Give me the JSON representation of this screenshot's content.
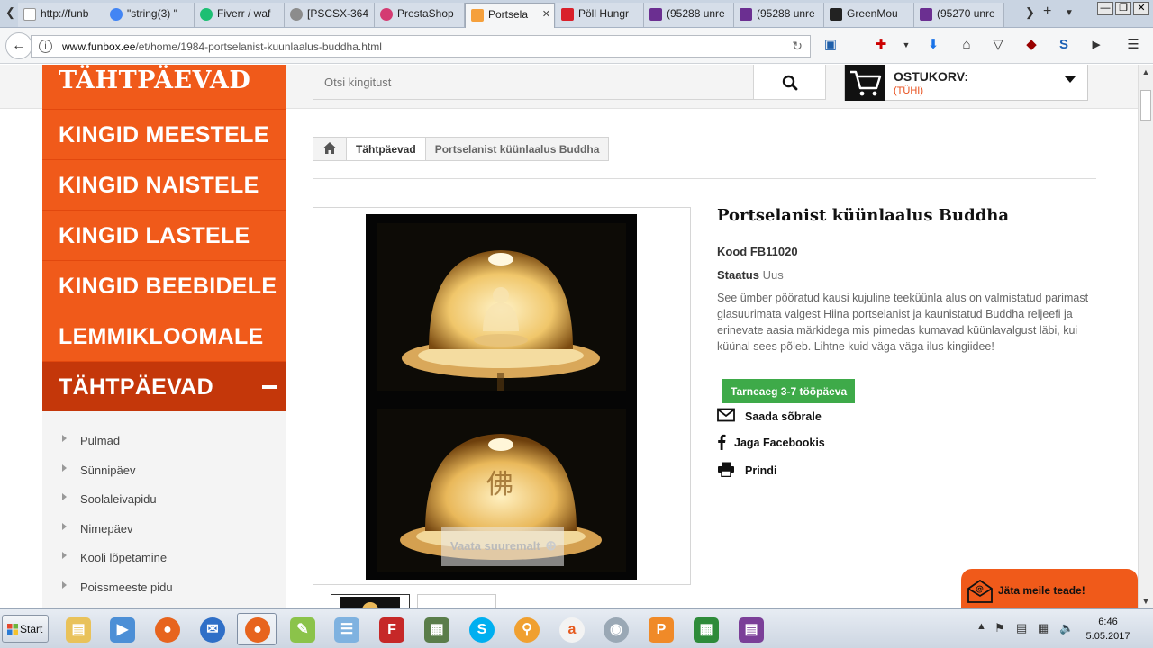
{
  "browser": {
    "tabs": [
      {
        "title": "http://funb",
        "color": "#b9c3cf"
      },
      {
        "title": "\"string(3) \"",
        "color": "#4285f4"
      },
      {
        "title": "Fiverr / waf",
        "color": "#1dbf73"
      },
      {
        "title": "[PSCSX-364",
        "color": "#8c8c8c"
      },
      {
        "title": "PrestaShop",
        "color": "#d43b72"
      },
      {
        "title": "Portsela",
        "color": "#f5a03c"
      },
      {
        "title": "Pöll Hungr",
        "color": "#d9202a"
      },
      {
        "title": "(95288 unre",
        "color": "#6b2f91"
      },
      {
        "title": "(95288 unre",
        "color": "#6b2f91"
      },
      {
        "title": "GreenMou",
        "color": "#222222"
      },
      {
        "title": "(95270 unre",
        "color": "#6b2f91"
      }
    ],
    "active_tab_index": 5,
    "url_host": "www.funbox.ee",
    "url_path": "/et/home/1984-portselanist-kuunlaalus-buddha.html"
  },
  "header": {
    "logo_text": "TÄHTPÄEVAD",
    "search_placeholder": "Otsi kingitust",
    "cart_title": "OSTUKORV:",
    "cart_status": "(TÜHI)"
  },
  "sidebar": {
    "items": [
      {
        "label": "KINGID MEESTELE"
      },
      {
        "label": "KINGID NAISTELE"
      },
      {
        "label": "KINGID LASTELE"
      },
      {
        "label": "KINGID BEEBIDELE"
      },
      {
        "label": "LEMMIKLOOMALE"
      },
      {
        "label": "TÄHTPÄEVAD"
      }
    ],
    "subitems": [
      {
        "label": "Pulmad"
      },
      {
        "label": "Sünnipäev"
      },
      {
        "label": "Soolaleivapidu"
      },
      {
        "label": "Nimepäev"
      },
      {
        "label": "Kooli lõpetamine"
      },
      {
        "label": "Poissmeeste pidu"
      }
    ]
  },
  "breadcrumb": {
    "category": "Tähtpäevad",
    "current": "Portselanist küünlaalus Buddha"
  },
  "product": {
    "title": "Portselanist küünlaalus Buddha",
    "code": "Kood FB11020",
    "status_label": "Staatus",
    "status_value": "Uus",
    "description": "See ümber pööratud kausi kujuline teeküünla alus on valmistatud parimast glasuurimata valgest Hiina portselanist ja kaunistatud Buddha reljeefi ja erinevate aasia märkidega mis pimedas kumavad küünlavalgust läbi, kui küünal sees põleb. Lihtne kuid väga väga ilus kingiidee!",
    "delivery": "Tarneaeg 3-7 tööpäeva",
    "zoom_label": "Vaata suuremalt",
    "actions": {
      "send_friend": "Saada sõbrale",
      "share_facebook": "Jaga Facebookis",
      "print": "Prindi"
    }
  },
  "feedback": {
    "label": "Jäta meile teade!"
  },
  "taskbar": {
    "start_label": "Start",
    "time": "6:46",
    "date": "5.05.2017"
  },
  "colors": {
    "brand_orange": "#f05a1a",
    "active_menu": "#c4370a",
    "delivery_green": "#3eaa49"
  }
}
